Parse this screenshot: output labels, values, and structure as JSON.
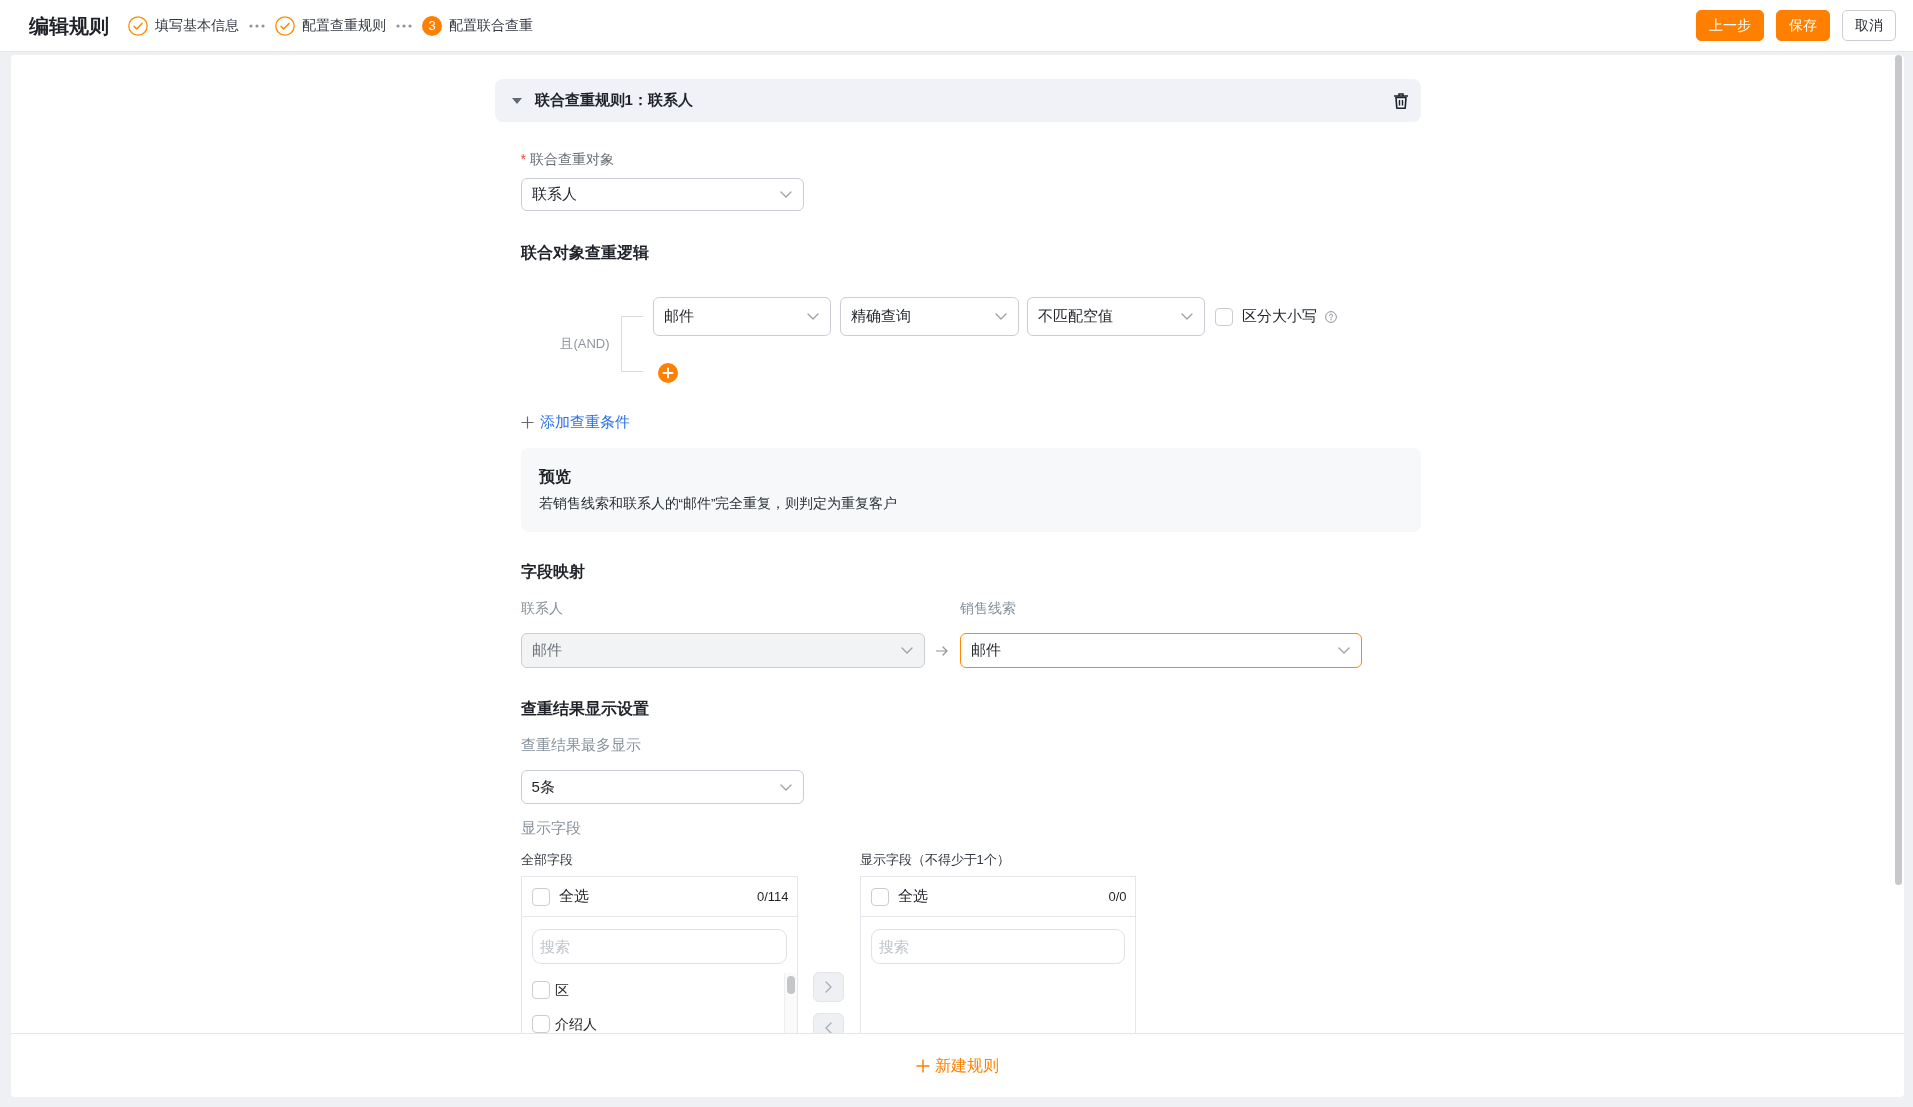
{
  "header": {
    "title": "编辑规则",
    "steps": [
      {
        "label": "填写基本信息",
        "kind": "done"
      },
      {
        "label": "配置查重规则",
        "kind": "done"
      },
      {
        "label": "配置联合查重",
        "kind": "current",
        "number": "3"
      }
    ],
    "buttons": [
      {
        "label": "上一步",
        "kind": "back"
      },
      {
        "label": "保存",
        "kind": "save"
      },
      {
        "label": "取消",
        "kind": "cancel"
      }
    ]
  },
  "rule": {
    "title": "联合查重规则1：联系人",
    "expanded": true,
    "target": {
      "required_mark": "*",
      "label": "联合查重对象",
      "value": "联系人"
    },
    "logic": {
      "title": "联合对象查重逻辑",
      "connector": "且(AND)",
      "conditions": [
        {
          "field": "邮件",
          "match": "精确查询",
          "empty_values": "不匹配空值",
          "case_sensitive": {
            "label": "区分大小写",
            "checked": false
          }
        }
      ],
      "add_condition": "添加查重条件"
    },
    "preview": {
      "title": "预览",
      "text": "若销售线索和联系人的“邮件”完全重复，则判定为重复客户"
    },
    "mapping": {
      "title": "字段映射",
      "source": {
        "label": "联系人",
        "value": "邮件",
        "disabled": true
      },
      "target": {
        "label": "销售线索",
        "value": "邮件",
        "focused": true
      }
    },
    "display": {
      "title": "查重结果显示设置",
      "max_label": "查重结果最多显示",
      "max_value": "5条",
      "fields_label": "显示字段",
      "transfer": {
        "available": {
          "title": "全部字段",
          "select_all": "全选",
          "checked": false,
          "count": "0/114",
          "placeholder": "搜索",
          "items": [
            {
              "label": "区",
              "checked": false
            },
            {
              "label": "介绍人",
              "checked": false
            }
          ]
        },
        "buttons": [
          {
            "kind": "right",
            "disabled": true
          },
          {
            "kind": "left",
            "disabled": true
          }
        ],
        "selected": {
          "title": "显示字段（不得少于1个）",
          "select_all": "全选",
          "checked": false,
          "count": "0/0",
          "placeholder": "搜索"
        }
      }
    }
  },
  "footer": {
    "new_rule": "新建规则"
  }
}
